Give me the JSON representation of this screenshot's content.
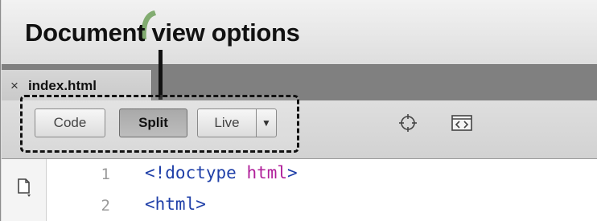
{
  "callout": {
    "title": "Document view options"
  },
  "tab": {
    "close_glyph": "×",
    "filename": "index.html"
  },
  "toolbar": {
    "view_buttons": [
      {
        "label": "Code",
        "selected": false
      },
      {
        "label": "Split",
        "selected": true
      },
      {
        "label": "Live",
        "selected": false
      }
    ],
    "live_dropdown_glyph": "▼",
    "icons": [
      "target-icon",
      "code-navigator-icon"
    ]
  },
  "editor": {
    "lines": [
      {
        "num": "1",
        "tag_open": "<!doctype ",
        "keyword": "html",
        "tag_close": ">"
      },
      {
        "num": "2",
        "tag_open": "<html>",
        "keyword": "",
        "tag_close": ""
      }
    ]
  },
  "colors": {
    "tag_blue": "#1f3fa8",
    "keyword_magenta": "#b0209a",
    "tabbar_gray": "#808080"
  }
}
